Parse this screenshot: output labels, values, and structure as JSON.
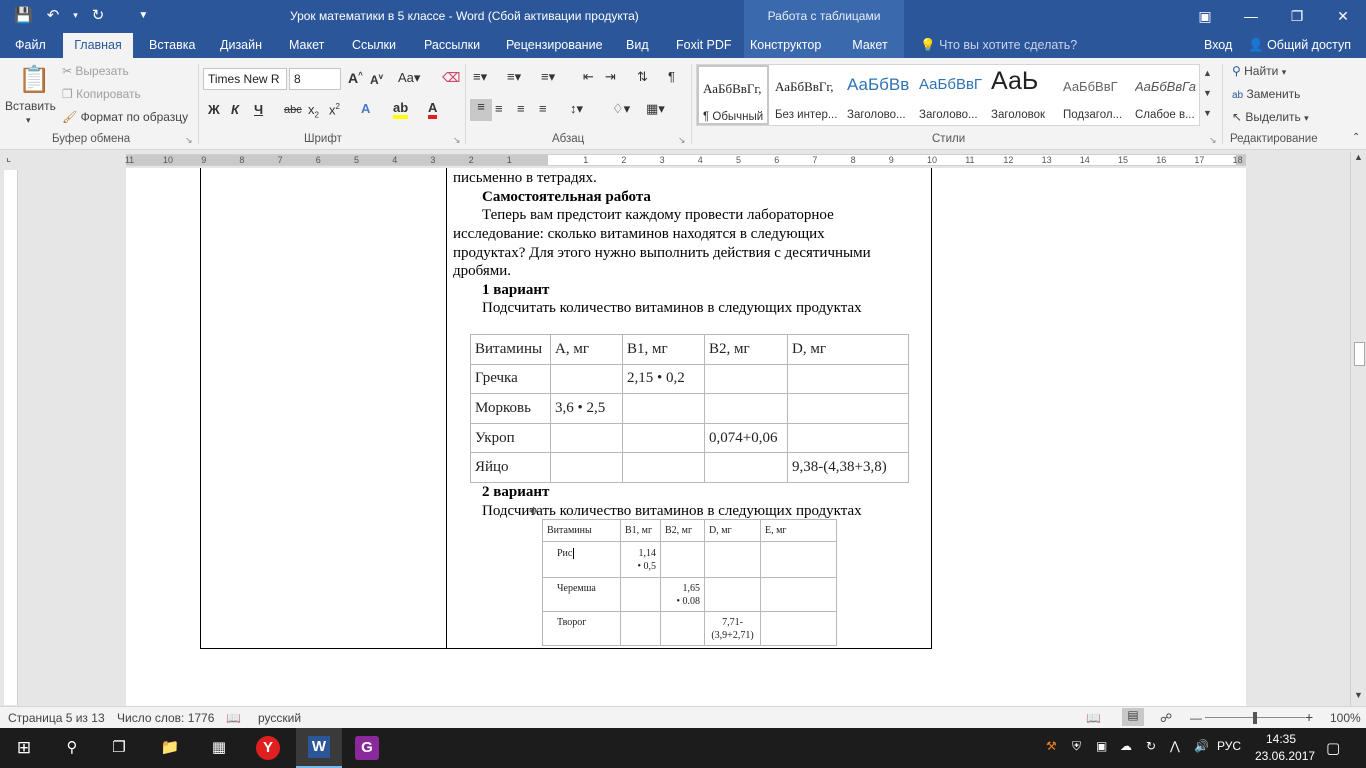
{
  "window": {
    "title": "Урок математики в 5 классе - Word (Сбой активации продукта)",
    "context_title": "Работа с таблицами"
  },
  "tabs": [
    {
      "label": "Файл"
    },
    {
      "label": "Главная"
    },
    {
      "label": "Вставка"
    },
    {
      "label": "Дизайн"
    },
    {
      "label": "Макет"
    },
    {
      "label": "Ссылки"
    },
    {
      "label": "Рассылки"
    },
    {
      "label": "Рецензирование"
    },
    {
      "label": "Вид"
    },
    {
      "label": "Foxit PDF"
    },
    {
      "label": "Конструктор"
    },
    {
      "label": "Макет"
    }
  ],
  "search_tab": "Что вы хотите сделать?",
  "login": "Вход",
  "share": "Общий доступ",
  "ribbon": {
    "clipboard": {
      "paste": "Вставить",
      "cut": "Вырезать",
      "copy": "Копировать",
      "format_painter": "Формат по образцу",
      "label": "Буфер обмена"
    },
    "font": {
      "name": "Times New R",
      "size": "8",
      "label": "Шрифт"
    },
    "paragraph": {
      "label": "Абзац"
    },
    "styles": {
      "items": [
        {
          "preview": "АаБбВвГг,",
          "name": "¶ Обычный"
        },
        {
          "preview": "АаБбВвГг,",
          "name": "Без интер..."
        },
        {
          "preview": "АаБбВв",
          "name": "Заголово..."
        },
        {
          "preview": "АаБбВвГ",
          "name": "Заголово..."
        },
        {
          "preview": "АаЬ",
          "name": "Заголовок"
        },
        {
          "preview": "АаБбВвГ",
          "name": "Подзагол..."
        },
        {
          "preview": "АаБбВвГа",
          "name": "Слабое в..."
        }
      ],
      "label": "Стили"
    },
    "editing": {
      "find": "Найти",
      "replace": "Заменить",
      "select": "Выделить",
      "label": "Редактирование"
    }
  },
  "ruler_numbers": [
    "11",
    "10",
    "9",
    "8",
    "7",
    "6",
    "5",
    "4",
    "3",
    "2",
    "1",
    "1",
    "2",
    "3",
    "4",
    "5",
    "6",
    "7",
    "8",
    "9",
    "10",
    "11",
    "12",
    "13",
    "14",
    "15",
    "16",
    "17",
    "18"
  ],
  "document": {
    "line_top": "письменно в тетрадях.",
    "heading1": "Самостоятельная работа",
    "para1_lines": [
      "Теперь вам предстоит каждому провести лабораторное",
      "исследование: сколько витаминов находятся в следующих",
      "продуктах? Для этого нужно выполнить действия с десятичными",
      "дробями."
    ],
    "variant1": "1 вариант",
    "variant1_text": "Подсчитать количество витаминов в следующих продуктах",
    "table1": {
      "headers": [
        "Витамины",
        "А, мг",
        "В1, мг",
        "В2, мг",
        "D, мг"
      ],
      "rows": [
        [
          "Гречка",
          "",
          "2,15 • 0,2",
          "",
          ""
        ],
        [
          "Морковь",
          "3,6 • 2,5",
          "",
          "",
          ""
        ],
        [
          "Укроп",
          "",
          "",
          "0,074+0,06",
          ""
        ],
        [
          "Яйцо",
          "",
          "",
          "",
          "9,38-(4,38+3,8)"
        ]
      ]
    },
    "variant2": "2 вариант",
    "variant2_text": "Подсчитать количество витаминов в следующих продуктах",
    "table2": {
      "headers": [
        "Витамины",
        "В1, мг",
        "В2, мг",
        "D, мг",
        "Е, мг"
      ],
      "rows": [
        [
          "Рис",
          "1,14\n• 0,5",
          "",
          "",
          ""
        ],
        [
          "Черемша",
          "",
          "1,65\n• 0.08",
          "",
          ""
        ],
        [
          "Творог",
          "",
          "",
          "7,71-\n(3,9+2,71)",
          ""
        ]
      ]
    }
  },
  "status": {
    "page": "Страница 5 из 13",
    "words": "Число слов: 1776",
    "language": "русский",
    "zoom": "100%",
    "zoom_level": 1.0
  },
  "taskbar": {
    "lang": "РУС",
    "time": "14:35",
    "date": "23.06.2017"
  },
  "colors": {
    "accent": "#2b579a",
    "ribbon_bg": "#f3f3f3",
    "taskbar": "#1c1c1c"
  }
}
